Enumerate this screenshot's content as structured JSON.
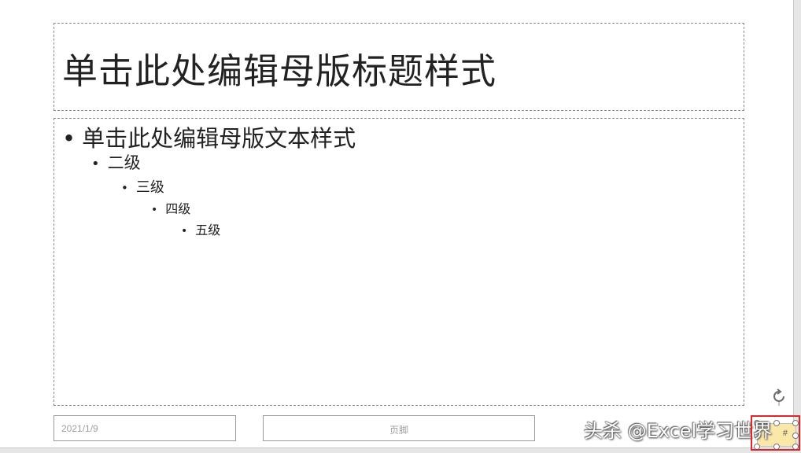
{
  "slide": {
    "title": "单击此处编辑母版标题样式",
    "body": {
      "level1": "单击此处编辑母版文本样式",
      "level2": "二级",
      "level3": "三级",
      "level4": "四级",
      "level5": "五级",
      "bullet_glyph": "•"
    },
    "date": "2021/1/9",
    "footer": "页脚",
    "slide_number": "#"
  },
  "watermark": "头杀 @Excel学习世界",
  "icons": {
    "rotate": "rotate-handle-icon"
  },
  "colors": {
    "highlight_border": "#e0262a",
    "selected_fill": "#fbe7a7"
  }
}
